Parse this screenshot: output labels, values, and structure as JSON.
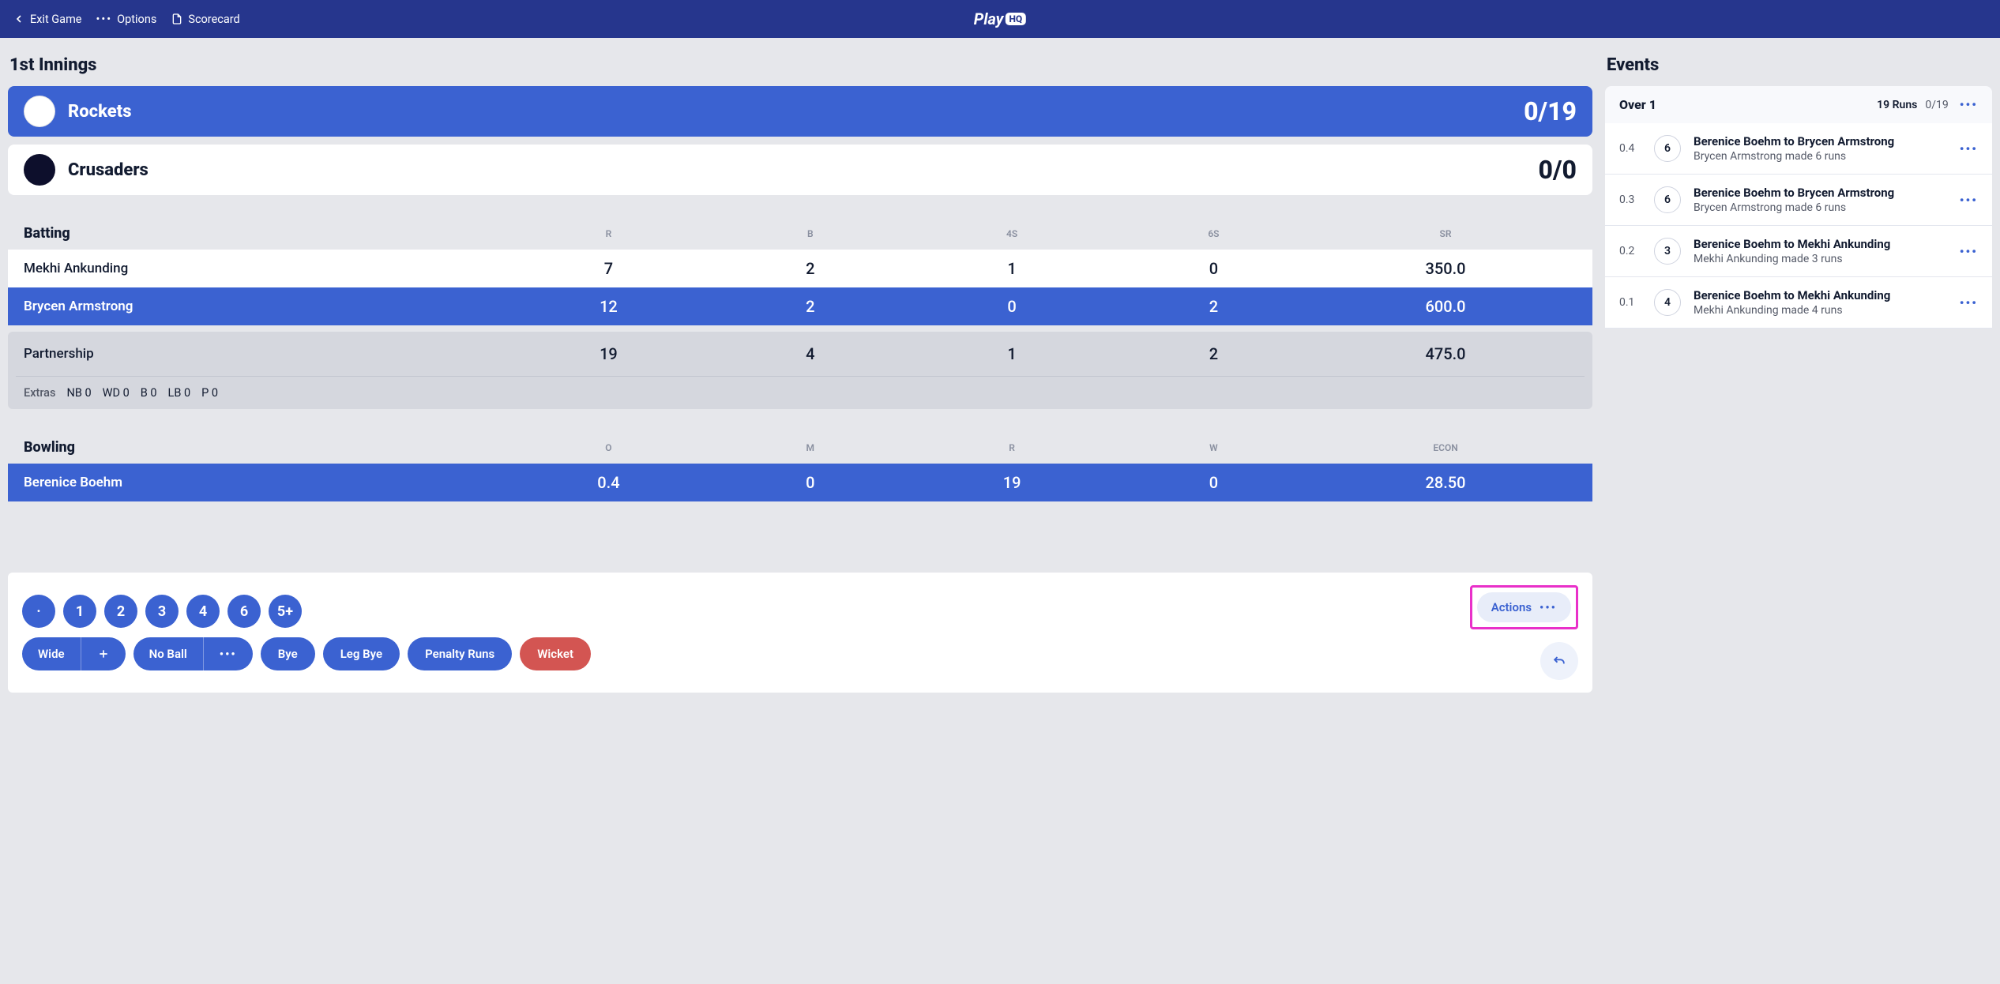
{
  "nav": {
    "exit": "Exit Game",
    "options": "Options",
    "scorecard": "Scorecard",
    "logo_prefix": "Play",
    "logo_badge": "HQ"
  },
  "innings_title": "1st Innings",
  "teams": [
    {
      "name": "Rockets",
      "score": "0/19",
      "jersey": "white",
      "active": true
    },
    {
      "name": "Crusaders",
      "score": "0/0",
      "jersey": "black",
      "active": false
    }
  ],
  "batting": {
    "title": "Batting",
    "columns": [
      "R",
      "B",
      "4S",
      "6S",
      "SR"
    ],
    "players": [
      {
        "name": "Mekhi Ankunding",
        "r": 7,
        "b": 2,
        "fours": 1,
        "sixes": 0,
        "sr": "350.0",
        "striker": false
      },
      {
        "name": "Brycen Armstrong",
        "r": 12,
        "b": 2,
        "fours": 0,
        "sixes": 2,
        "sr": "600.0",
        "striker": true
      }
    ],
    "partnership": {
      "label": "Partnership",
      "r": 19,
      "b": 4,
      "fours": 1,
      "sixes": 2,
      "sr": "475.0"
    },
    "extras": {
      "label": "Extras",
      "items": [
        "NB 0",
        "WD 0",
        "B 0",
        "LB 0",
        "P 0"
      ]
    }
  },
  "bowling": {
    "title": "Bowling",
    "columns": [
      "O",
      "M",
      "R",
      "W",
      "ECON"
    ],
    "bowlers": [
      {
        "name": "Berenice Boehm",
        "o": "0.4",
        "m": 0,
        "r": 19,
        "w": 0,
        "econ": "28.50",
        "current": true
      }
    ]
  },
  "controls": {
    "runs": [
      "·",
      "1",
      "2",
      "3",
      "4",
      "6",
      "5+"
    ],
    "wide": "Wide",
    "noball": "No Ball",
    "bye": "Bye",
    "legbye": "Leg Bye",
    "penalty": "Penalty Runs",
    "wicket": "Wicket",
    "actions": "Actions"
  },
  "events": {
    "title": "Events",
    "over_label": "Over 1",
    "over_runs": "19 Runs",
    "over_score": "0/19",
    "balls": [
      {
        "ball": "0.4",
        "badge": "6",
        "title": "Berenice Boehm to Brycen Armstrong",
        "sub": "Brycen Armstrong made 6 runs"
      },
      {
        "ball": "0.3",
        "badge": "6",
        "title": "Berenice Boehm to Brycen Armstrong",
        "sub": "Brycen Armstrong made 6 runs"
      },
      {
        "ball": "0.2",
        "badge": "3",
        "title": "Berenice Boehm to Mekhi Ankunding",
        "sub": "Mekhi Ankunding made 3 runs"
      },
      {
        "ball": "0.1",
        "badge": "4",
        "title": "Berenice Boehm to Mekhi Ankunding",
        "sub": "Mekhi Ankunding made 4 runs"
      }
    ]
  }
}
